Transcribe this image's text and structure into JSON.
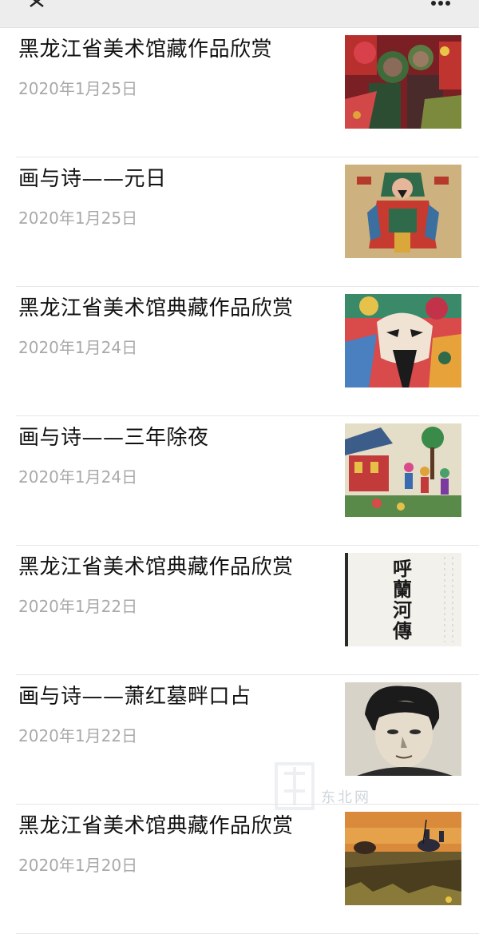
{
  "topbar": {
    "close_icon": "close-icon",
    "more_icon": "more-dots-icon"
  },
  "articles": [
    {
      "title": "黑龙江省美术馆藏作品欣赏",
      "date": "2020年1月25日",
      "thumb": "woodcut-figures-thumbnail"
    },
    {
      "title": "画与诗——元日",
      "date": "2020年1月25日",
      "thumb": "door-god-thumbnail"
    },
    {
      "title": "黑龙江省美术馆典藏作品欣赏",
      "date": "2020年1月24日",
      "thumb": "opera-mask-thumbnail"
    },
    {
      "title": "画与诗——三年除夜",
      "date": "2020年1月24日",
      "thumb": "festival-scene-thumbnail"
    },
    {
      "title": "黑龙江省美术馆典藏作品欣赏",
      "date": "2020年1月22日",
      "thumb": "calligraphy-thumbnail",
      "thumb_text": [
        "呼",
        "蘭",
        "河",
        "傳"
      ]
    },
    {
      "title": "画与诗——萧红墓畔口占",
      "date": "2020年1月22日",
      "thumb": "portrait-print-thumbnail"
    },
    {
      "title": "黑龙江省美术馆典藏作品欣赏",
      "date": "2020年1月20日",
      "thumb": "grassland-riders-thumbnail"
    }
  ],
  "watermark": {
    "text": "东北网",
    "icon": "site-watermark-icon"
  }
}
